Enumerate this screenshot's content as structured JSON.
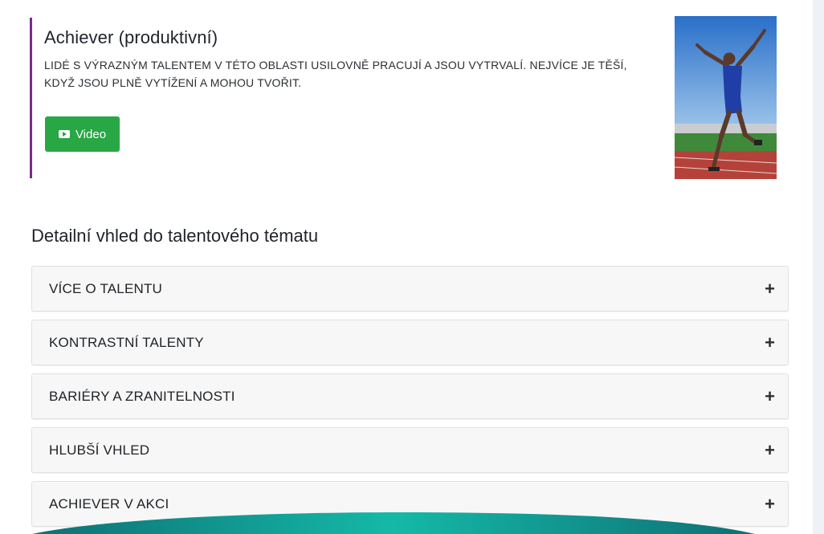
{
  "talent": {
    "title": "Achiever (produktivní)",
    "description": "LIDÉ S VÝRAZNÝM TALENTEM V TÉTO OBLASTI USILOVNĚ PRACUJÍ A JSOU VYTRVALÍ. NEJVÍCE JE TĚŠÍ, KDYŽ JSOU PLNĚ VYTÍŽENÍ A MOHOU TVOŘIT.",
    "video_label": "Video",
    "video_icon": "youtube-play-icon",
    "accent_color": "#7b2a8a",
    "button_color": "#28a745"
  },
  "section": {
    "title": "Detailní vhled do talentového tématu"
  },
  "accordion": [
    {
      "label": "VÍCE O TALENTU",
      "icon": "plus-icon",
      "symbol": "+"
    },
    {
      "label": "KONTRASTNÍ TALENTY",
      "icon": "plus-icon",
      "symbol": "+"
    },
    {
      "label": "BARIÉRY A ZRANITELNOSTI",
      "icon": "plus-icon",
      "symbol": "+"
    },
    {
      "label": "HLUBŠÍ VHLED",
      "icon": "plus-icon",
      "symbol": "+"
    },
    {
      "label": "ACHIEVER V AKCI",
      "icon": "plus-icon",
      "symbol": "+"
    }
  ],
  "colors": {
    "wave_dark": "#0e6f74",
    "wave_light": "#15b9a8"
  }
}
